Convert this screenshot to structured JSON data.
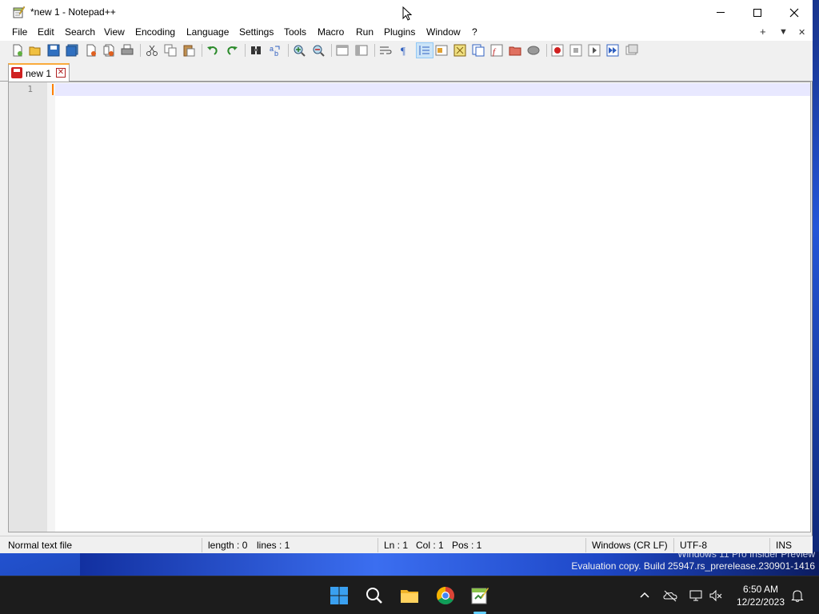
{
  "window": {
    "title": "*new 1 - Notepad++"
  },
  "menu": {
    "items": [
      "File",
      "Edit",
      "Search",
      "View",
      "Encoding",
      "Language",
      "Settings",
      "Tools",
      "Macro",
      "Run",
      "Plugins",
      "Window",
      "?"
    ],
    "right": [
      "+",
      "▼",
      "✕"
    ]
  },
  "tabs": [
    {
      "label": "new 1",
      "modified": true
    }
  ],
  "editor": {
    "line_numbers": [
      "1"
    ],
    "content": ""
  },
  "status": {
    "file_type": "Normal text file",
    "length": "length : 0",
    "lines": "lines : 1",
    "ln": "Ln : 1",
    "col": "Col : 1",
    "pos": "Pos : 1",
    "eol": "Windows (CR LF)",
    "encoding": "UTF-8",
    "mode": "INS"
  },
  "desktop": {
    "watermark_line1": "Windows 11 Pro Insider Preview",
    "watermark_line2": "Evaluation copy. Build 25947.rs_prerelease.230901-1416"
  },
  "taskbar": {
    "apps": [
      "start-icon",
      "search-icon",
      "file-explorer-icon",
      "chrome-icon",
      "notepadpp-icon"
    ],
    "tray": [
      "chevron-up-icon",
      "onedrive-offline-icon",
      "network-icon",
      "volume-muted-icon",
      "notification-bell-icon"
    ],
    "time": "6:50 AM",
    "date": "12/22/2023"
  },
  "colors": {
    "tab_accent": "#faaa3c",
    "caret": "#ff8000",
    "current_line": "#e8e8ff",
    "taskbar_bg": "#1c1c1c",
    "active_indicator": "#60cdff"
  }
}
